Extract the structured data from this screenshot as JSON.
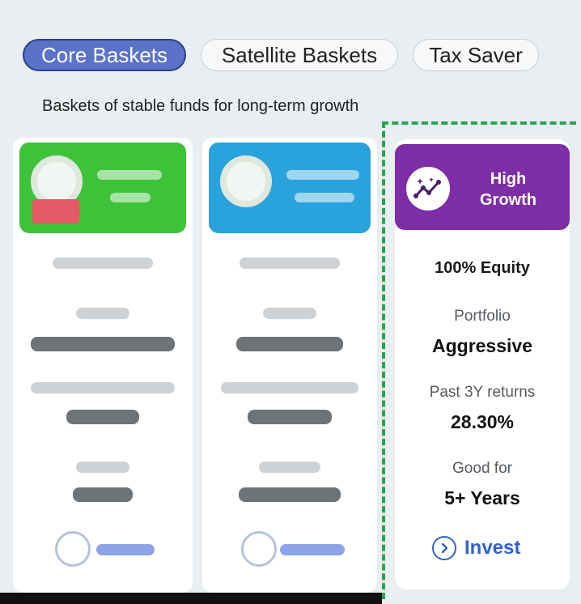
{
  "tabs": [
    {
      "label": "Core Baskets",
      "active": true
    },
    {
      "label": "Satellite Baskets",
      "active": false
    },
    {
      "label": "Tax Saver",
      "active": false
    }
  ],
  "subtitle": "Baskets of stable funds for long-term growth",
  "feature_card": {
    "icon": "growth-chart-icon",
    "title_line1": "High",
    "title_line2": "Growth",
    "header_color": "#7d2da6",
    "allocation": "100% Equity",
    "portfolio_label": "Portfolio",
    "portfolio_value": "Aggressive",
    "returns_label": "Past 3Y returns",
    "returns_value": "28.30%",
    "horizon_label": "Good for",
    "horizon_value": "5+ Years",
    "cta_label": "Invest",
    "cta_icon": "chevron-right-circle-icon"
  },
  "colors": {
    "active_tab": "#5a72c8",
    "highlight_border": "#21a84f",
    "invest": "#2e62d6",
    "green_card": "#3ec23a",
    "blue_card": "#2aa2dc"
  }
}
